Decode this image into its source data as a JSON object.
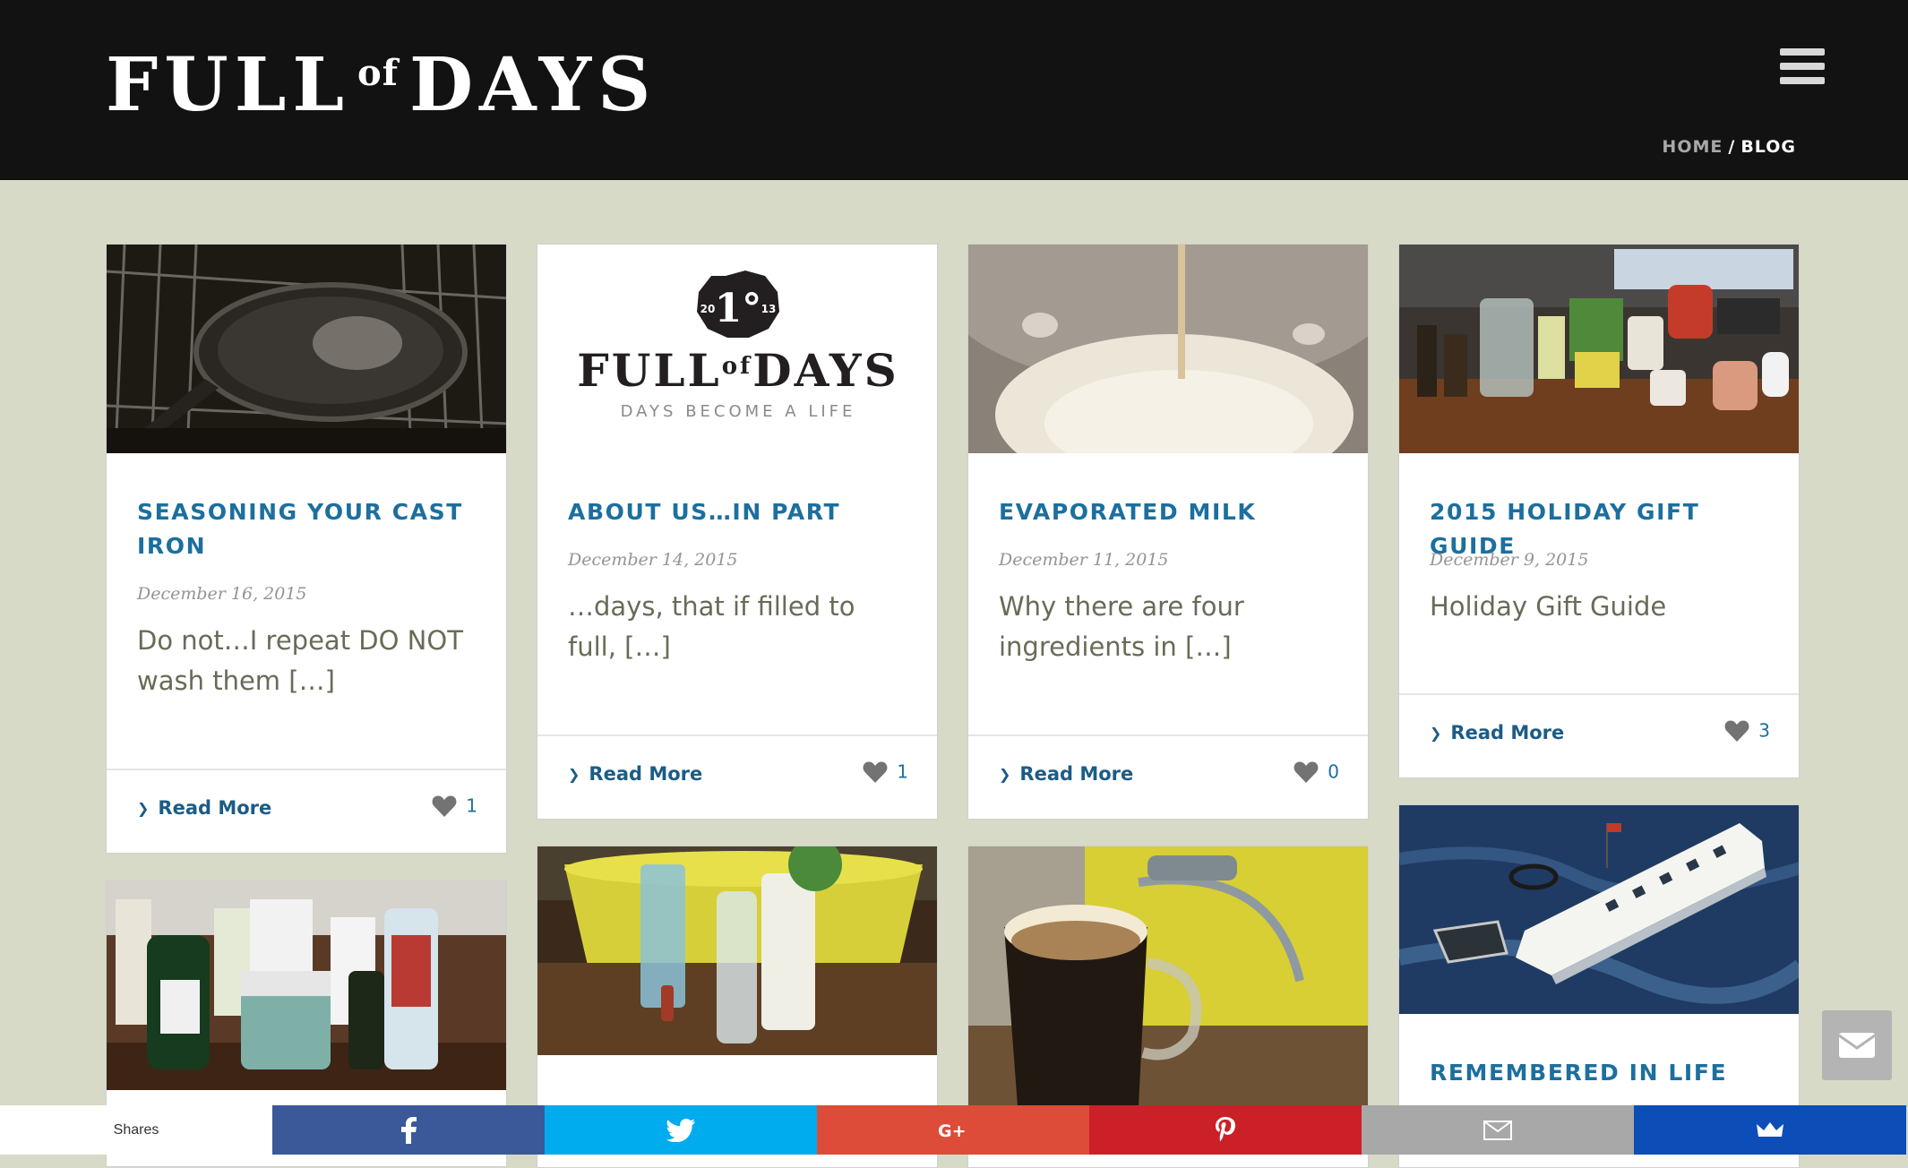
{
  "site": {
    "logo_main_left": "FULL",
    "logo_of": "of",
    "logo_main_right": "DAYS"
  },
  "breadcrumb": {
    "home": "HOME",
    "separator": "/",
    "current": "BLOG"
  },
  "posts": [
    {
      "title": "SEASONING YOUR CAST IRON",
      "date": "December 16, 2015",
      "excerpt": "Do not…I repeat DO NOT wash them […]",
      "read_more": "Read More",
      "likes": "1"
    },
    {
      "title": "ABOUT US…IN PART",
      "date": "December 14, 2015",
      "excerpt": "…days, that if filled to full, […]",
      "read_more": "Read More",
      "likes": "1",
      "logo_badge_number": "1°",
      "logo_badge_year_left": "20",
      "logo_badge_year_right": "13",
      "logo_tagline": "DAYS BECOME A LIFE"
    },
    {
      "title": "EVAPORATED MILK",
      "date": "December 11, 2015",
      "excerpt": "Why there are four ingredients in […]",
      "read_more": "Read More",
      "likes": "0"
    },
    {
      "title": "2015 HOLIDAY GIFT GUIDE",
      "date": "December 9, 2015",
      "excerpt": "Holiday Gift Guide",
      "read_more": "Read More",
      "likes": "3"
    },
    {
      "title": "REMEMBERED IN LIFE"
    }
  ],
  "share_bar": {
    "label": "Shares",
    "buttons": [
      {
        "name": "facebook",
        "color": "#3b5998",
        "glyph": "f"
      },
      {
        "name": "twitter",
        "color": "#00aced",
        "glyph": "twitter-bird"
      },
      {
        "name": "google-plus",
        "color": "#dd4b39",
        "glyph": "G+"
      },
      {
        "name": "pinterest",
        "color": "#cb2027",
        "glyph": "P"
      },
      {
        "name": "email",
        "color": "#a8a8a8",
        "glyph": "envelope"
      },
      {
        "name": "sumome",
        "color": "#0c4db8",
        "glyph": "sumome"
      }
    ]
  },
  "icons": {
    "menu": "hamburger-icon",
    "chevron": "chevron-right-icon",
    "heart": "heart-icon",
    "contact": "envelope-icon"
  },
  "colors": {
    "header_bg": "#121212",
    "page_bg": "#d7dac6",
    "title": "#1c6f9e",
    "excerpt": "#6a6a58"
  }
}
